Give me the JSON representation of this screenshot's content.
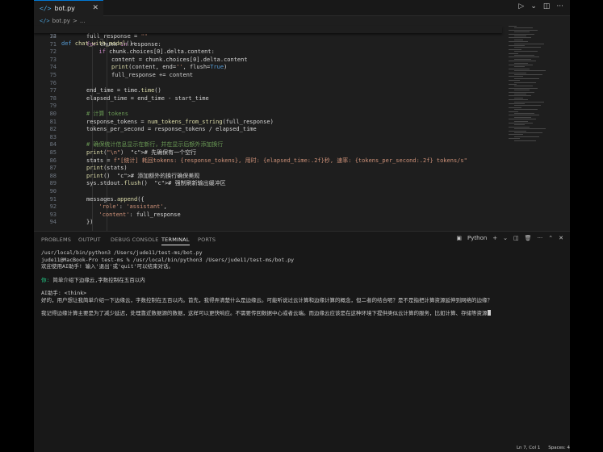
{
  "tab": {
    "icon": "python-file-icon",
    "name": "bot.py"
  },
  "breadcrumb": {
    "file": "bot.py",
    "sep": ">",
    "more": "..."
  },
  "sticky": {
    "ln": "32",
    "code": "def chat_with_model():"
  },
  "code_lines": [
    {
      "ln": "74",
      "code": "full_response = \"\""
    },
    {
      "ln": "71",
      "code": "for chunk in response:"
    },
    {
      "ln": "72",
      "code": "if chunk.choices[0].delta.content:"
    },
    {
      "ln": "73",
      "code": "content = chunk.choices[0].delta.content"
    },
    {
      "ln": "74",
      "code": "print(content, end='', flush=True)"
    },
    {
      "ln": "75",
      "code": "full_response += content"
    },
    {
      "ln": "76",
      "code": ""
    },
    {
      "ln": "77",
      "code": "end_time = time.time()"
    },
    {
      "ln": "78",
      "code": "elapsed_time = end_time - start_time"
    },
    {
      "ln": "79",
      "code": ""
    },
    {
      "ln": "80",
      "code": "# 计算 tokens"
    },
    {
      "ln": "81",
      "code": "response_tokens = num_tokens_from_string(full_response)"
    },
    {
      "ln": "82",
      "code": "tokens_per_second = response_tokens / elapsed_time"
    },
    {
      "ln": "83",
      "code": ""
    },
    {
      "ln": "84",
      "code": "# 确保统计信息显示在新行，并在显示后额外添加换行"
    },
    {
      "ln": "85",
      "code": "print(\"\\n\")  # 先确保有一个空行"
    },
    {
      "ln": "86",
      "code": "stats = f\"[统计] 耗回tokens: {response_tokens}, 用时: {elapsed_time:.2f}秒, 速率: {tokens_per_second:.2f} tokens/s\""
    },
    {
      "ln": "87",
      "code": "print(stats)"
    },
    {
      "ln": "88",
      "code": "print()  # 添加额外的换行确保美观"
    },
    {
      "ln": "89",
      "code": "sys.stdout.flush()  # 强制刷新输出缓冲区"
    },
    {
      "ln": "90",
      "code": ""
    },
    {
      "ln": "91",
      "code": "messages.append({"
    },
    {
      "ln": "92",
      "code": "'role': 'assistant',"
    },
    {
      "ln": "93",
      "code": "'content': full_response"
    },
    {
      "ln": "94",
      "code": "})"
    }
  ],
  "panel": {
    "tabs": [
      "PROBLEMS",
      "OUTPUT",
      "DEBUG CONSOLE",
      "TERMINAL",
      "PORTS"
    ],
    "shell": "Python"
  },
  "terminal": {
    "l1": "/usr/local/bin/python3 /Users/jude11/test-ms/bot.py",
    "l2": "jude11@MacBook-Pro test-ms % /usr/local/bin/python3 /Users/jude11/test-ms/bot.py",
    "l3": "欢迎使用AI助手! 输入'退出'或'quit'可以结束对话。",
    "q_marker": "你:",
    "question": "简单介绍下边缘云,字数控制在五百以内",
    "a_label": "AI助手: <think>",
    "a1": "好的，用户想让我简单介绍一下边缘云，字数控制在五百以内。首先，我得弄清楚什么是边缘云。可能听说过云计算和边缘计算的概念，但二者的结合呢？是不是指把计算资源延伸到网络的边缘？",
    "a2": "我记得边缘计算主要是为了减少延迟，处理靠近数据源的数据，这样可以更快响应。不需要传回数据中心或者云端。而边缘云应该是在这种环境下提供类似云计算的服务，比如计算、存储等资源"
  },
  "status": {
    "pos": "Ln 7, Col 1",
    "spaces": "Spaces: 4"
  }
}
